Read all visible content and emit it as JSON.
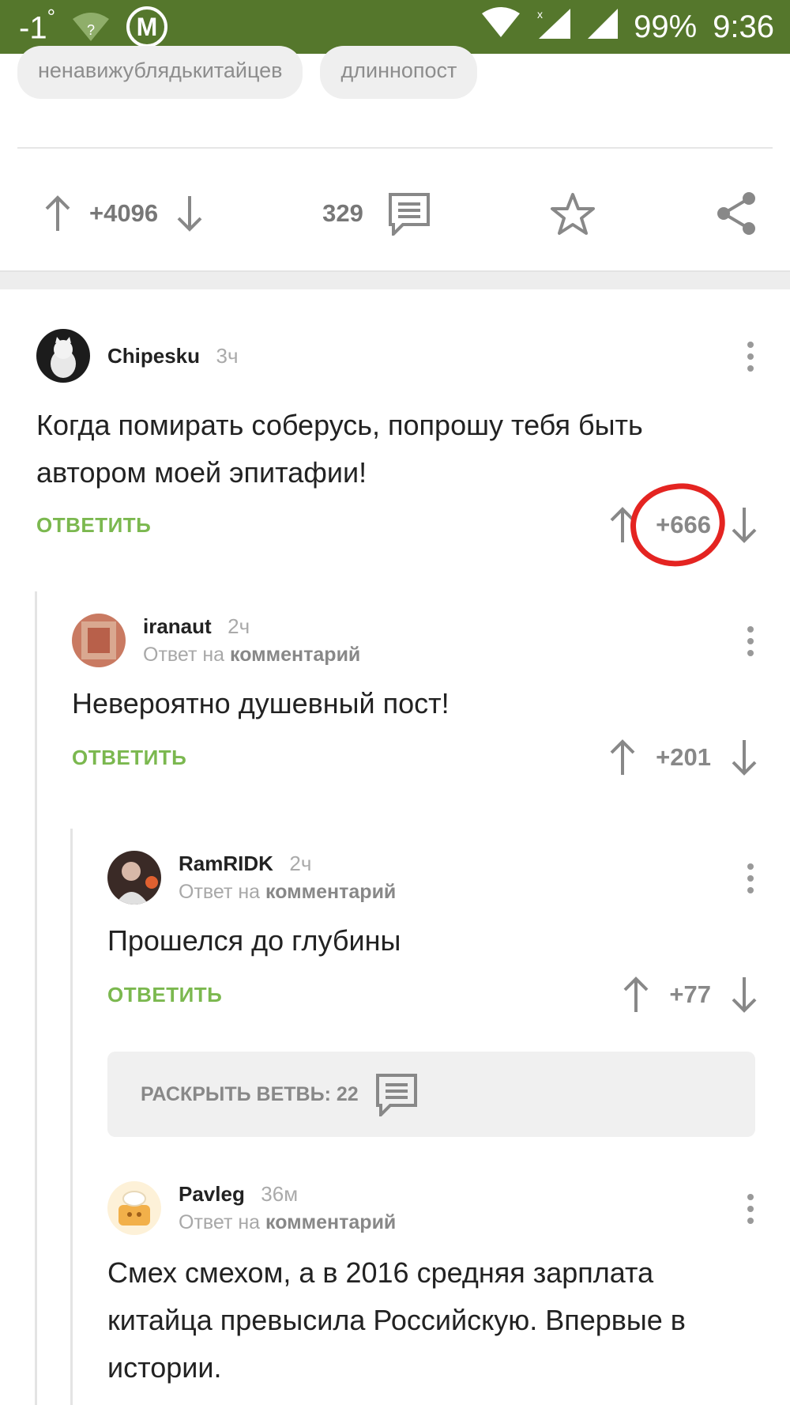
{
  "status_bar": {
    "temperature": "-1",
    "temperature_unit": "°",
    "metro_letter": "M",
    "battery": "99%",
    "time": "9:36",
    "background": "#55772c"
  },
  "tags": [
    "ненавижублядькитайцев",
    "длиннопост"
  ],
  "post_actions": {
    "rating": "+4096",
    "comments_count": "329"
  },
  "comments": [
    {
      "user": "Chipesku",
      "time": "3ч",
      "reply_to_prefix": "",
      "reply_to_link": "",
      "text": "Когда помирать соберусь, попрошу тебя быть автором моей эпитафии!",
      "reply_label": "ОТВЕТИТЬ",
      "rating": "+666",
      "highlighted": true
    },
    {
      "user": "iranaut",
      "time": "2ч",
      "reply_to_prefix": "Ответ на",
      "reply_to_link": "комментарий",
      "text": "Невероятно душевный пост!",
      "reply_label": "ОТВЕТИТЬ",
      "rating": "+201"
    },
    {
      "user": "RamRIDK",
      "time": "2ч",
      "reply_to_prefix": "Ответ на",
      "reply_to_link": "комментарий",
      "text": "Прошелся до глубины",
      "reply_label": "ОТВЕТИТЬ",
      "rating": "+77"
    },
    {
      "user": "Pavleg",
      "time": "36м",
      "reply_to_prefix": "Ответ на",
      "reply_to_link": "комментарий",
      "text": "Смех смехом, а в 2016 средняя зарплата китайца превысила Российскую. Впервые в истории."
    }
  ],
  "expand_branch": {
    "label": "РАСКРЫТЬ ВЕТВЬ: 22"
  },
  "colors": {
    "accent_green": "#7bb84f",
    "highlight_red": "#e42421"
  }
}
